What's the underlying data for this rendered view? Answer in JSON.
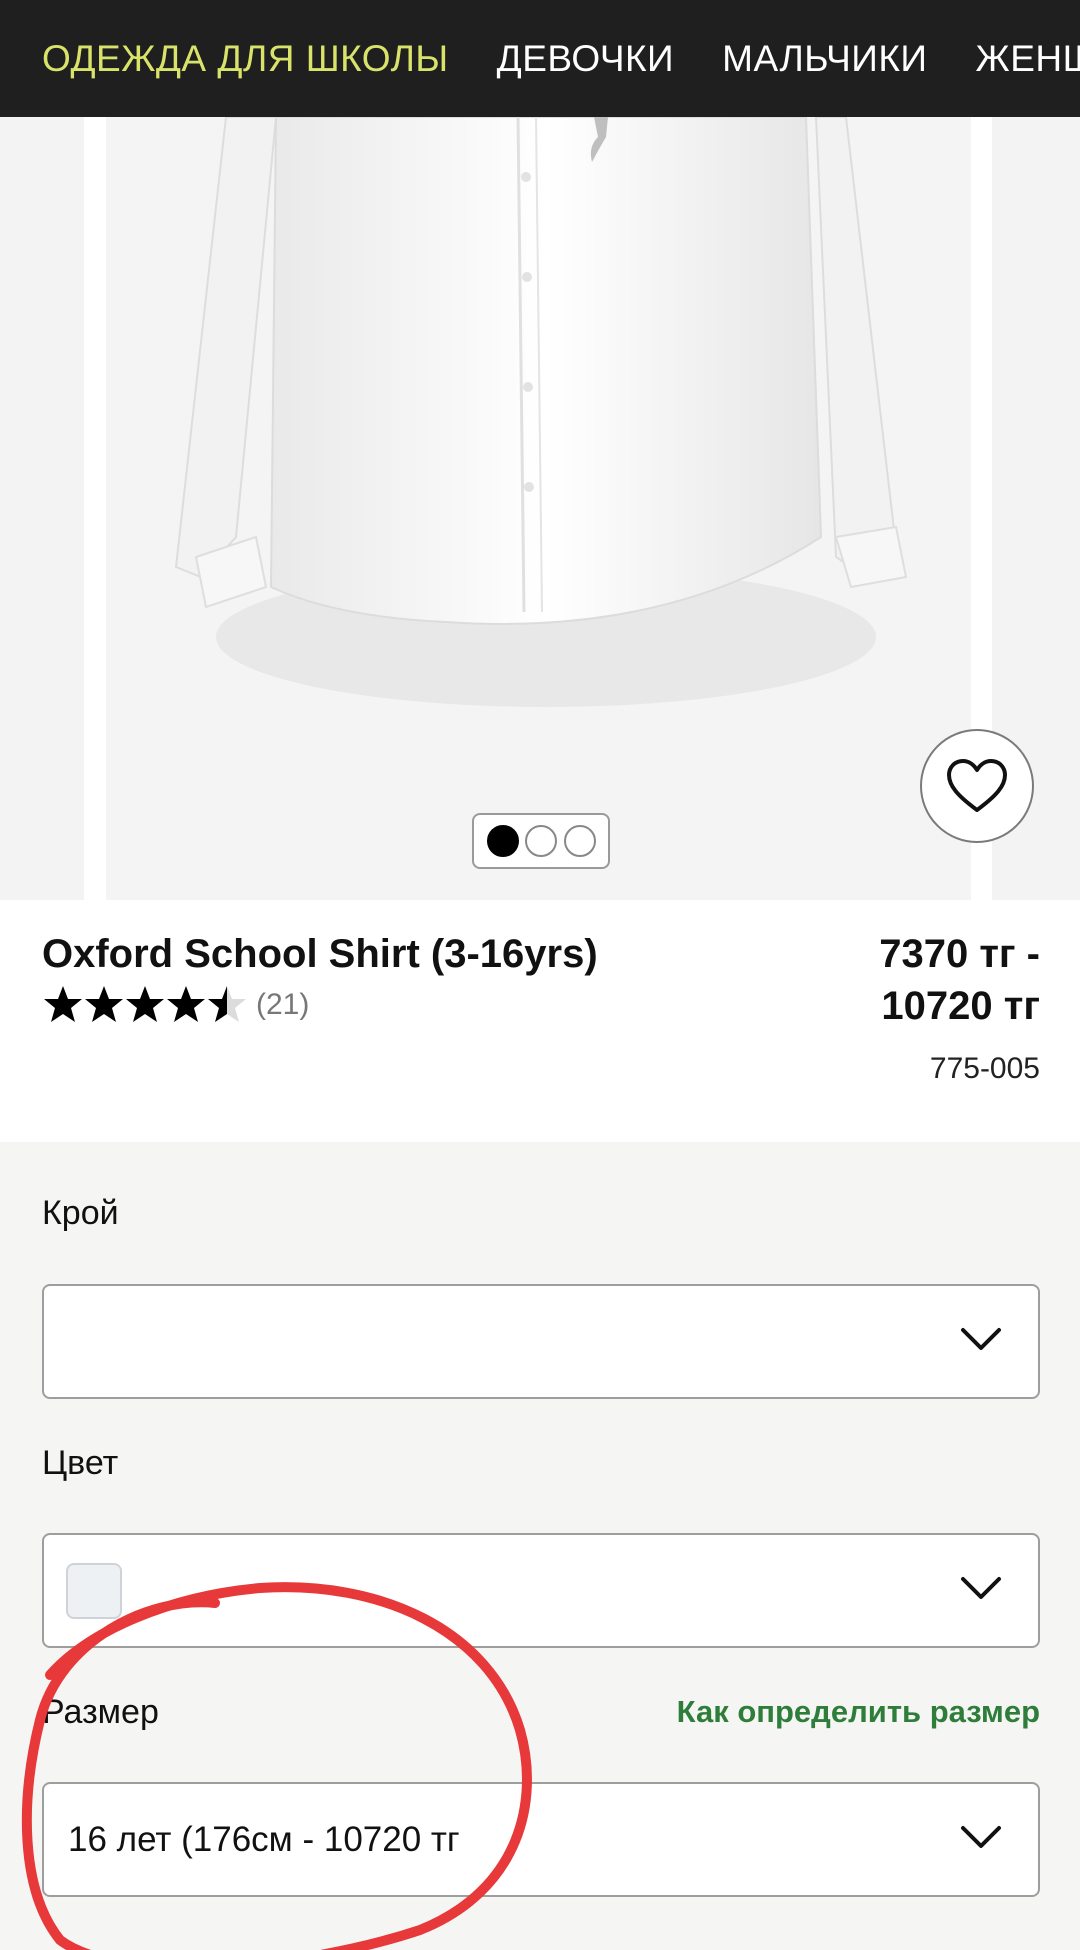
{
  "nav": {
    "items": [
      "ОДЕЖДА ДЛЯ ШКОЛЫ",
      "ДЕВОЧКИ",
      "МАЛЬЧИКИ",
      "ЖЕНЩИ"
    ]
  },
  "carousel": {
    "slide_count": 3,
    "active_slide": 1
  },
  "product": {
    "title": "Oxford School Shirt (3-16yrs)",
    "rating": 4.5,
    "reviews": "(21)",
    "price_line1": "7370 тг -",
    "price_line2": "10720 тг",
    "sku": "775-005"
  },
  "options": {
    "fit_label": "Крой",
    "fit_value": "",
    "color_label": "Цвет",
    "size_label": "Размер",
    "size_guide_link": "Как определить размер",
    "size_value": "16 лет (176см - 10720 тг"
  },
  "colors": {
    "nav_bg": "#1f1f1f",
    "nav_accent": "#d9e36a",
    "link_green": "#2f7d3a",
    "annotation_red": "#e8393a"
  },
  "icons": {
    "favorite": "heart-icon",
    "dropdown": "chevron-down-icon",
    "star": "star-icon"
  }
}
